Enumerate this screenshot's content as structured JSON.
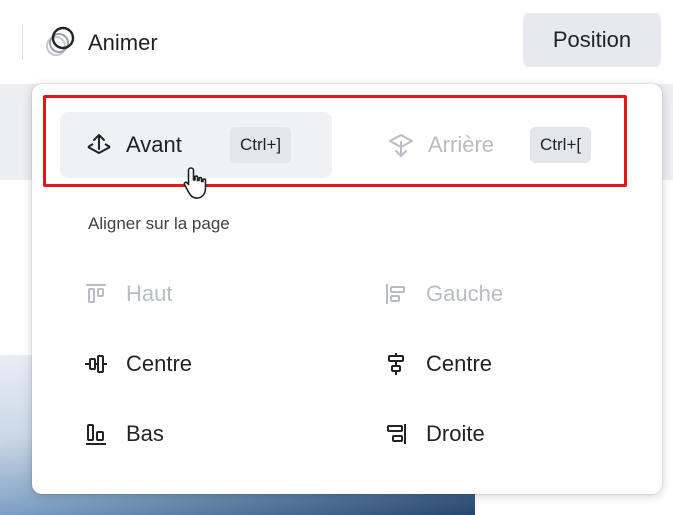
{
  "toolbar": {
    "animate_label": "Animer",
    "animate_icon": "animate-rings-icon",
    "position_label": "Position"
  },
  "menu": {
    "forward": {
      "label": "Avant",
      "shortcut": "Ctrl+]",
      "icon": "bring-forward-icon",
      "enabled": true
    },
    "backward": {
      "label": "Arrière",
      "shortcut": "Ctrl+[",
      "icon": "send-backward-icon",
      "enabled": false
    },
    "align_section_title": "Aligner sur la page",
    "align": {
      "top": {
        "label": "Haut",
        "icon": "align-top-icon",
        "enabled": false
      },
      "left": {
        "label": "Gauche",
        "icon": "align-left-icon",
        "enabled": false
      },
      "middle": {
        "label": "Centre",
        "icon": "align-middle-icon",
        "enabled": true
      },
      "center": {
        "label": "Centre",
        "icon": "align-center-icon",
        "enabled": true
      },
      "bottom": {
        "label": "Bas",
        "icon": "align-bottom-icon",
        "enabled": true
      },
      "right": {
        "label": "Droite",
        "icon": "align-right-icon",
        "enabled": true
      }
    }
  },
  "colors": {
    "highlight": "#e1181b",
    "disabled_text": "#b8bdc4",
    "button_bg": "#e6e9ee"
  }
}
